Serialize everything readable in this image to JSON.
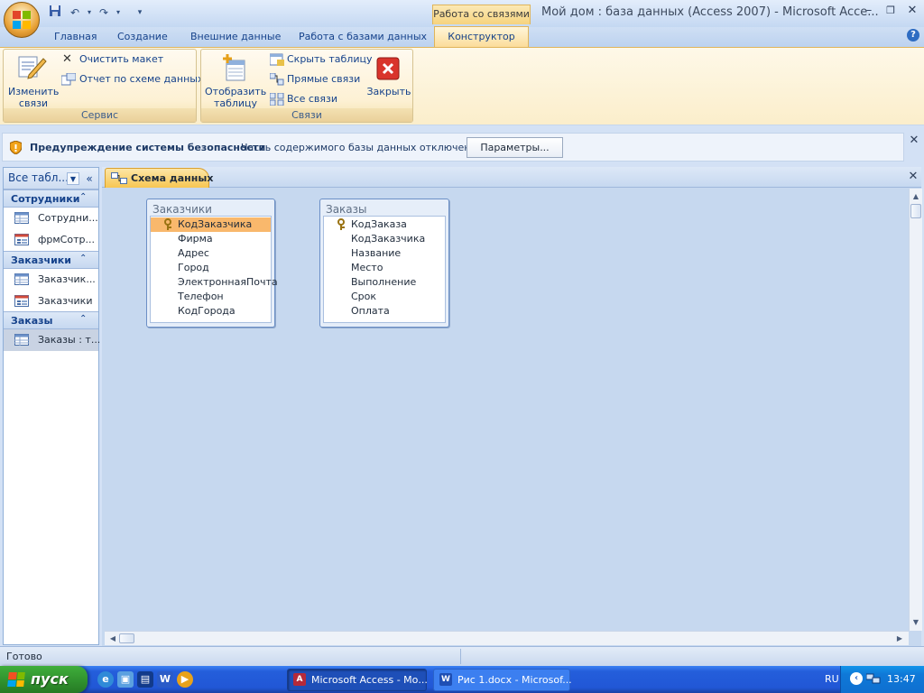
{
  "window": {
    "context_tab_group": "Работа со связями",
    "title": "Мой дом : база данных (Access 2007) - Microsoft Acce..."
  },
  "quick_access": {
    "save_icon": "save-icon",
    "undo_icon": "undo-icon",
    "redo_icon": "redo-icon"
  },
  "tabs": {
    "home": "Главная",
    "create": "Создание",
    "external": "Внешние данные",
    "dbtools": "Работа с базами данных",
    "designer": "Конструктор"
  },
  "ribbon": {
    "service": {
      "caption": "Сервис",
      "edit_relations": [
        "Изменить",
        "связи"
      ],
      "clear_layout": "Очистить макет",
      "report": "Отчет по схеме данных"
    },
    "relations": {
      "caption": "Связи",
      "show_table": [
        "Отобразить",
        "таблицу"
      ],
      "hide_table": "Скрыть таблицу",
      "direct_relations": "Прямые связи",
      "all_relations": "Все связи",
      "close": "Закрыть"
    }
  },
  "security_bar": {
    "title": "Предупреждение системы безопасности",
    "message": "Часть содержимого базы данных отключено",
    "button": "Параметры..."
  },
  "nav": {
    "header": "Все табл...",
    "groups": [
      {
        "name": "Сотрудники",
        "items": [
          {
            "label": "Сотрудни...",
            "icon": "table-icon"
          },
          {
            "label": "фрмСотр...",
            "icon": "form-icon"
          }
        ]
      },
      {
        "name": "Заказчики",
        "items": [
          {
            "label": "Заказчик...",
            "icon": "table-icon"
          },
          {
            "label": "Заказчики",
            "icon": "form-icon"
          }
        ]
      },
      {
        "name": "Заказы",
        "items": [
          {
            "label": "Заказы : т...",
            "icon": "table-icon",
            "selected": true
          }
        ]
      }
    ]
  },
  "document": {
    "tab": "Схема данных",
    "tables": [
      {
        "name": "Заказчики",
        "fields": [
          "КодЗаказчика",
          "Фирма",
          "Адрес",
          "Город",
          "ЭлектроннаяПочта",
          "Телефон",
          "КодГорода"
        ],
        "primary_key": "КодЗаказчика"
      },
      {
        "name": "Заказы",
        "fields": [
          "КодЗаказа",
          "КодЗаказчика",
          "Название",
          "Место",
          "Выполнение",
          "Срок",
          "Оплата"
        ],
        "primary_key": "КодЗаказа"
      }
    ]
  },
  "status": "Готово",
  "taskbar": {
    "start": "пуск",
    "tasks": [
      "Microsoft Access - Мо...",
      "Рис 1.docx - Microsof..."
    ],
    "lang": "RU",
    "time": "13:47"
  },
  "colors": {
    "ribbon_active": "#fbdc9a",
    "pk_highlight": "#f9b86c",
    "taskbar": "#245edb",
    "start_green": "#2f8f2d"
  }
}
